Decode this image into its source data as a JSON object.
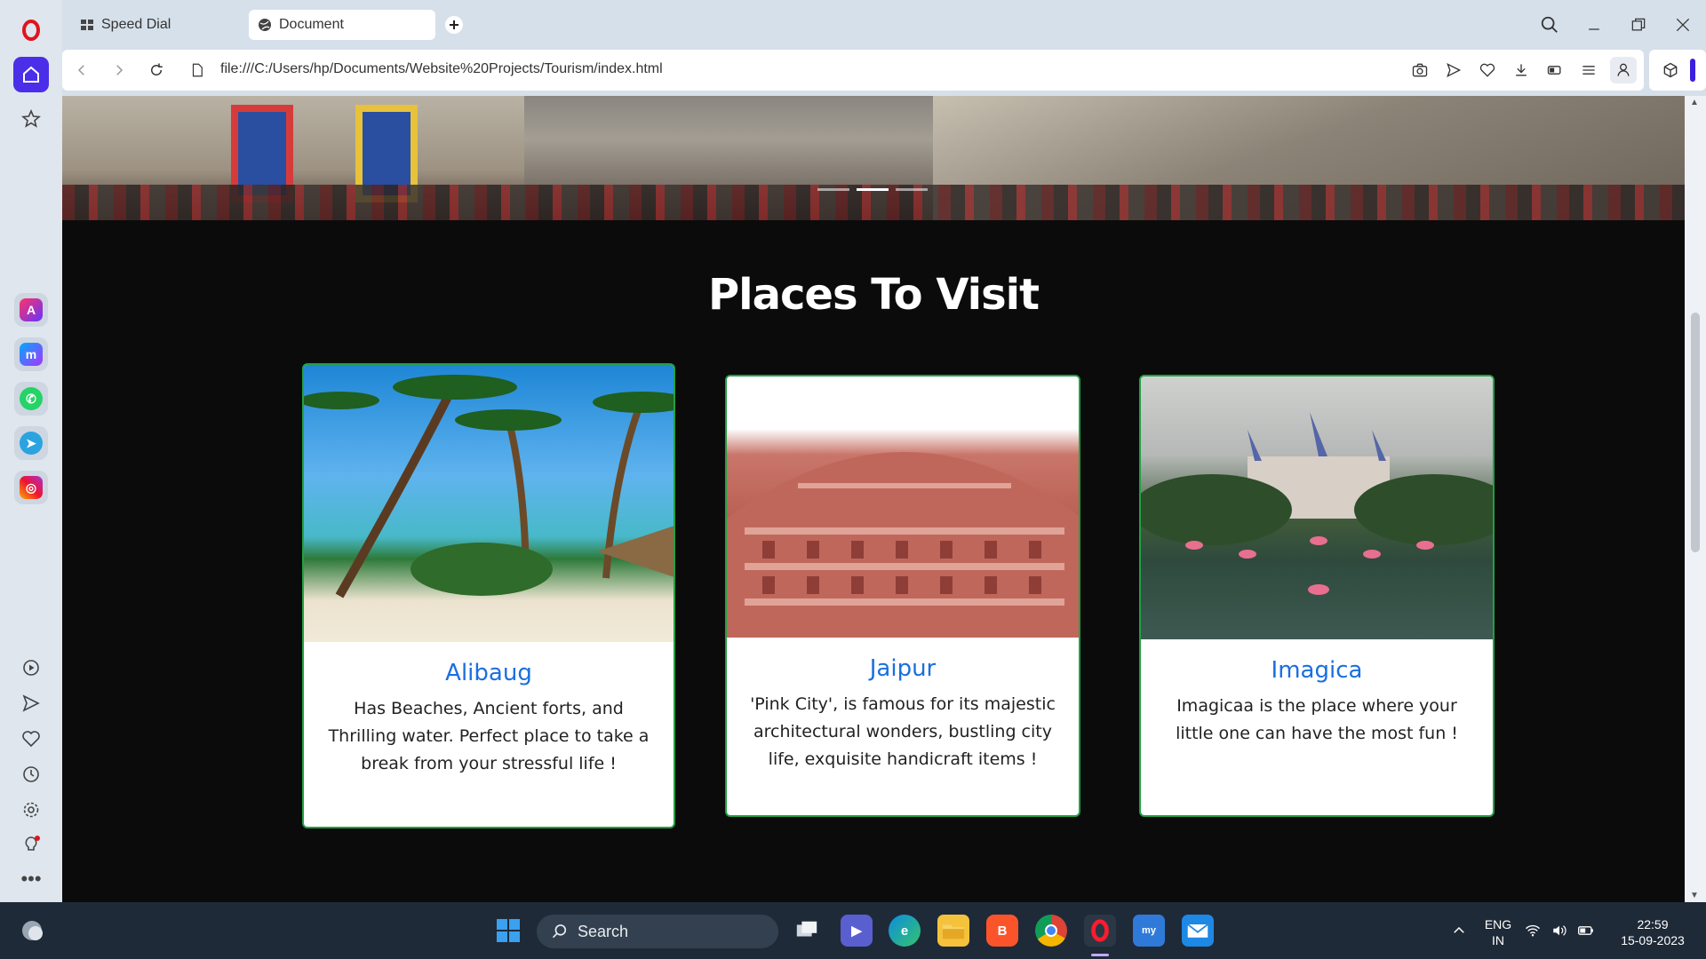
{
  "browser": {
    "tabs": [
      {
        "label": "Speed Dial"
      },
      {
        "label": "Document"
      }
    ],
    "url": "file:///C:/Users/hp/Documents/Website%20Projects/Tourism/index.html"
  },
  "page": {
    "heading": "Places To Visit",
    "cards": [
      {
        "title": "Alibaug",
        "description": "Has Beaches, Ancient forts, and Thrilling water. Perfect place to take a break from your stressful life !"
      },
      {
        "title": "Jaipur",
        "description": "'Pink City', is famous for its majestic architectural wonders, bustling city life, exquisite handicraft items !"
      },
      {
        "title": "Imagica",
        "description": "Imagicaa is the place where your little one can have the most fun !"
      }
    ]
  },
  "taskbar": {
    "search_label": "Search",
    "lang_top": "ENG",
    "lang_bottom": "IN",
    "time": "22:59",
    "date": "15-09-2023"
  },
  "colors": {
    "card_border": "#22a045",
    "card_title": "#1a6fe0",
    "page_bg": "#0b0b0b"
  }
}
